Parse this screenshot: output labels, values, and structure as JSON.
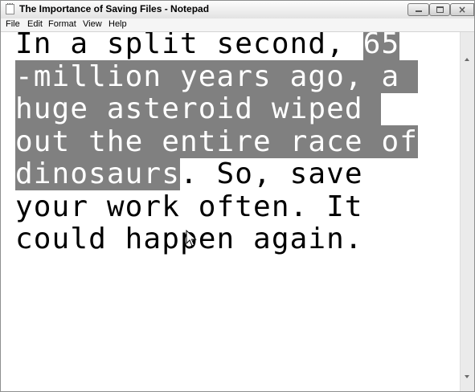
{
  "window": {
    "title": "The Importance of Saving Files - Notepad"
  },
  "menu": [
    "File",
    "Edit",
    "Format",
    "View",
    "Help"
  ],
  "document": {
    "lines": [
      {
        "plain": "In a split second, ",
        "selected": "65"
      },
      {
        "plain": "",
        "selected": "-million years ago, a "
      },
      {
        "plain": "",
        "selected": "huge asteroid wiped "
      },
      {
        "plain": "",
        "selected": "out the entire race of"
      },
      {
        "selected": "dinosaurs",
        "plain": ". So, save"
      },
      {
        "plain": "your work often. It"
      },
      {
        "plain": "could happen again."
      }
    ]
  },
  "colors": {
    "selection_background": "#808080",
    "selection_text": "#ffffff"
  },
  "icons": {
    "app": "notepad-icon",
    "pointer": "mouse-pointer-icon"
  }
}
